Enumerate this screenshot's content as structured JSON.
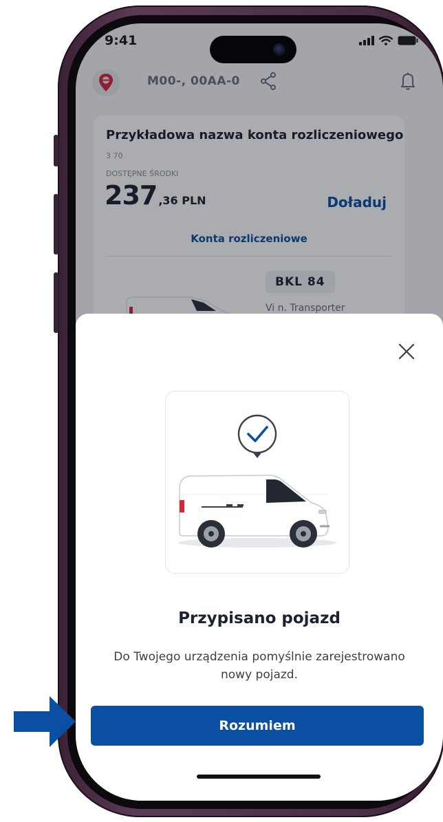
{
  "status_bar": {
    "time": "9:41"
  },
  "header": {
    "device_id_masked": "M00-,   00AA-0"
  },
  "account": {
    "name": "Przykładowa nazwa konta rozliczeniowego",
    "number_masked": "3   70",
    "funds_label": "DOSTĘPNE ŚRODKI",
    "amount_int": "237",
    "amount_rest": ",36 PLN",
    "topup_label": "Doładuj",
    "accounts_link": "Konta rozliczeniowe"
  },
  "vehicle": {
    "plate_masked": "BKL   84",
    "model_masked": "Vi                  n. Transporter"
  },
  "modal": {
    "title": "Przypisano pojazd",
    "description": "Do Twojego urządzenia pomyślnie zarejestrowano nowy pojazd.",
    "confirm_label": "Rozumiem"
  },
  "colors": {
    "primary": "#0a4fa1",
    "brand_red": "#d8253c",
    "frame": "#4a2d45",
    "overlay": "rgba(12,16,28,0.35)"
  },
  "icons": {
    "logo": "e-location-logo-icon",
    "share": "share-icon",
    "bell": "bell-icon",
    "close": "close-icon",
    "check": "check-badge-icon",
    "arrow": "pointer-arrow-icon"
  }
}
